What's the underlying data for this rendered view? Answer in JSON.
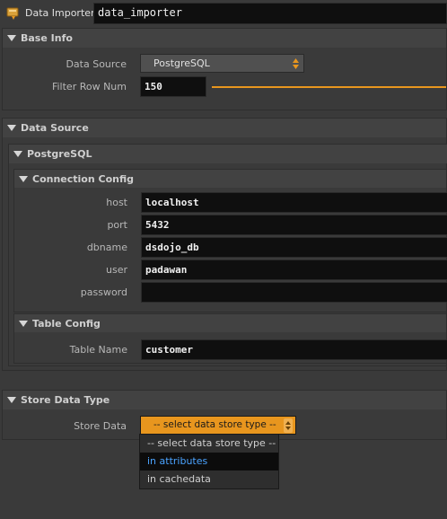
{
  "node": {
    "type_label": "Data Importer",
    "name": "data_importer"
  },
  "base_info": {
    "title": "Base Info",
    "data_source_label": "Data Source",
    "data_source_value": "PostgreSQL",
    "filter_label": "Filter Row Num",
    "filter_value": "150"
  },
  "data_source": {
    "title": "Data Source",
    "postgres_title": "PostgreSQL",
    "connection": {
      "title": "Connection Config",
      "host_label": "host",
      "host_value": "localhost",
      "port_label": "port",
      "port_value": "5432",
      "dbname_label": "dbname",
      "dbname_value": "dsdojo_db",
      "user_label": "user",
      "user_value": "padawan",
      "password_label": "password",
      "password_value": ""
    },
    "table": {
      "title": "Table Config",
      "table_name_label": "Table Name",
      "table_name_value": "customer"
    }
  },
  "store": {
    "title": "Store Data Type",
    "store_label": "Store Data",
    "selected": "-- select data store type --",
    "options": [
      "-- select data store type --",
      "in attributes",
      "in cachedata"
    ],
    "highlighted_index": 1
  },
  "colors": {
    "accent": "#e8961e",
    "highlight_text": "#4aa3ff"
  }
}
